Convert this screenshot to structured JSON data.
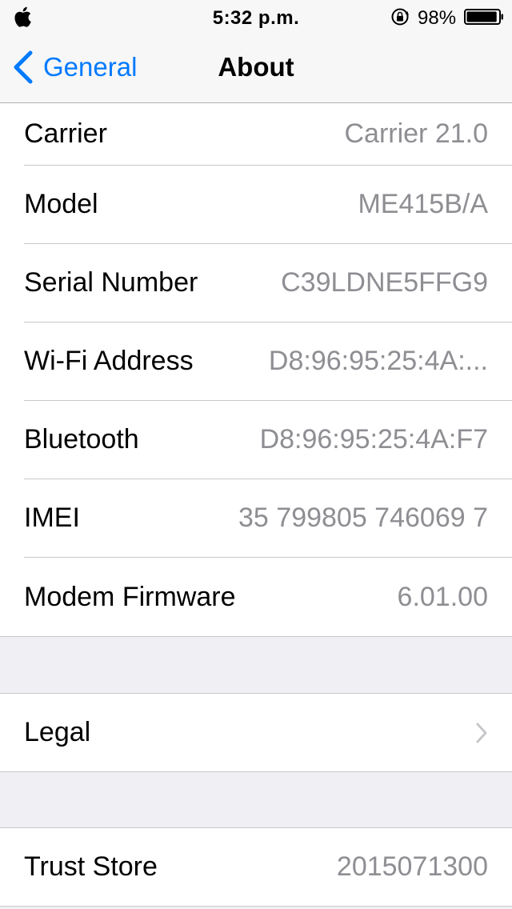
{
  "status_bar": {
    "time": "5:32 p.m.",
    "battery_percent": "98%",
    "battery_level": 0.98,
    "icons": [
      "apple-logo-icon",
      "orientation-lock-icon",
      "battery-icon"
    ]
  },
  "nav": {
    "back_label": "General",
    "title": "About",
    "accent_color": "#007aff"
  },
  "info_rows": [
    {
      "label": "Carrier",
      "value": "Carrier 21.0"
    },
    {
      "label": "Model",
      "value": "ME415B/A"
    },
    {
      "label": "Serial Number",
      "value": "C39LDNE5FFG9"
    },
    {
      "label": "Wi-Fi Address",
      "value": "D8:96:95:25:4A:..."
    },
    {
      "label": "Bluetooth",
      "value": "D8:96:95:25:4A:F7"
    },
    {
      "label": "IMEI",
      "value": "35 799805 746069 7"
    },
    {
      "label": "Modem Firmware",
      "value": "6.01.00"
    }
  ],
  "legal": {
    "label": "Legal",
    "icon": "chevron-right-icon"
  },
  "trust_store": {
    "label": "Trust Store",
    "value": "2015071300"
  }
}
